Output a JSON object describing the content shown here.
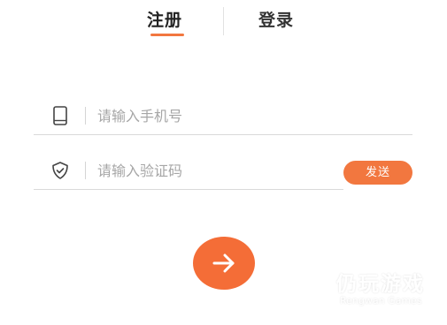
{
  "tabs": {
    "register_label": "注册",
    "login_label": "登录",
    "active": "register"
  },
  "form": {
    "phone": {
      "placeholder": "请输入手机号",
      "value": ""
    },
    "code": {
      "placeholder": "请输入验证码",
      "value": ""
    },
    "send_label": "发送"
  },
  "icons": {
    "phone": "phone-icon",
    "code": "shield-check-icon",
    "submit": "arrow-right-icon"
  },
  "watermark": {
    "name": "仍玩游戏",
    "sub": "Rengwan Games"
  },
  "colors": {
    "accent": "#f2773f",
    "text": "#333333",
    "placeholder": "#a6a6a6"
  }
}
